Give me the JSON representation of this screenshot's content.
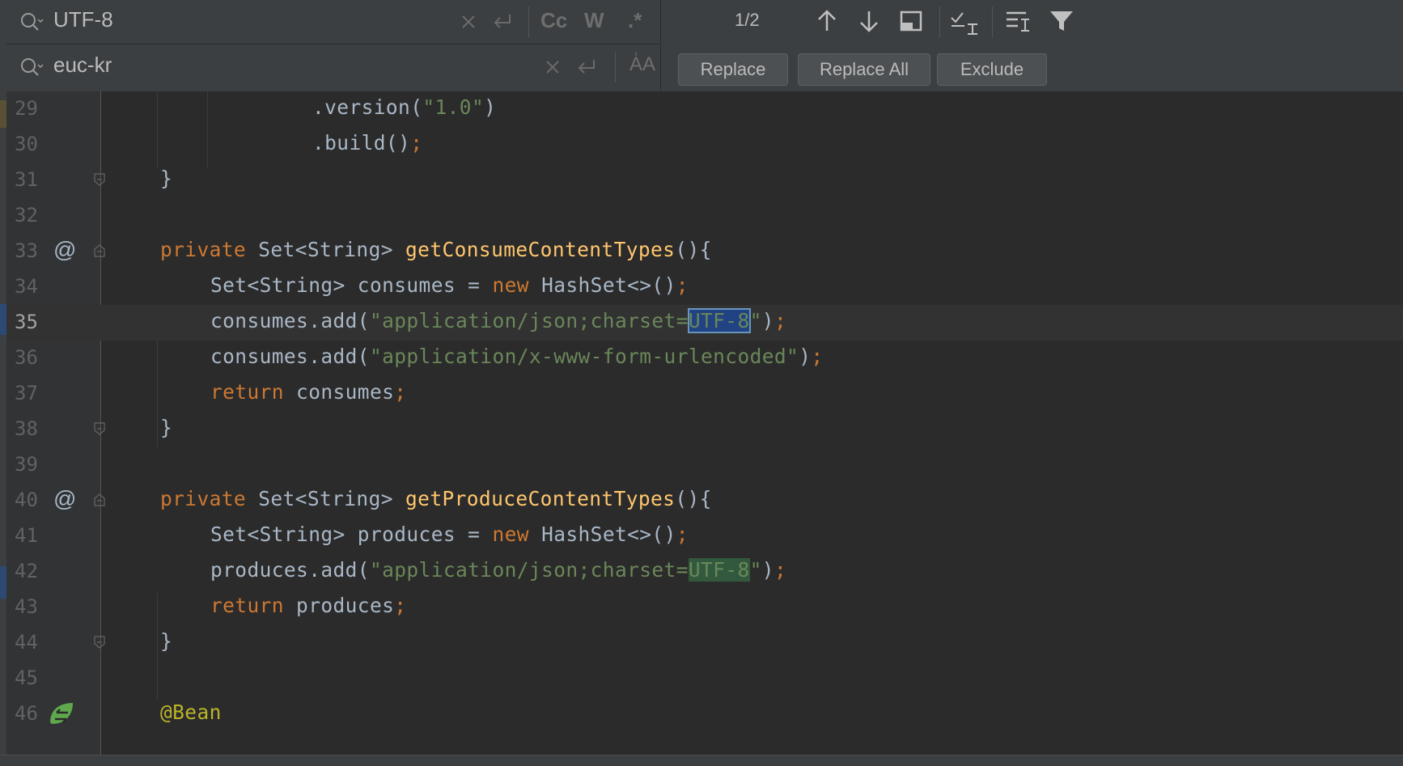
{
  "find": {
    "search_value": "UTF-8",
    "replace_value": "euc-kr",
    "match_count": "1/2",
    "options": {
      "match_case": "Cc",
      "words": "W",
      "regex": ".*"
    },
    "preserve_case": "A͑A"
  },
  "actions": {
    "replace": "Replace",
    "replace_all": "Replace All",
    "exclude": "Exclude"
  },
  "icons": {
    "search": "search-icon",
    "clear": "close-icon",
    "newline": "newline-icon",
    "prev": "arrow-up-icon",
    "next": "arrow-down-icon",
    "select_all": "select-all-occurrences-icon",
    "in_selection": "in-selection-icon",
    "multiline": "multiline-icon",
    "filter": "filter-icon"
  },
  "colors": {
    "keyword": "#cc7832",
    "string": "#6a8759",
    "function": "#ffc66d",
    "annotation": "#bbb529",
    "current_match": "#214283",
    "other_match": "#32593d"
  },
  "editor": {
    "lines": [
      {
        "num": "29"
      },
      {
        "num": "30"
      },
      {
        "num": "31"
      },
      {
        "num": "32"
      },
      {
        "num": "33"
      },
      {
        "num": "34"
      },
      {
        "num": "35"
      },
      {
        "num": "36"
      },
      {
        "num": "37"
      },
      {
        "num": "38"
      },
      {
        "num": "39"
      },
      {
        "num": "40"
      },
      {
        "num": "41"
      },
      {
        "num": "42"
      },
      {
        "num": "43"
      },
      {
        "num": "44"
      },
      {
        "num": "45"
      },
      {
        "num": "46"
      }
    ],
    "tokens": {
      "l29": ".version(",
      "l29s": "\"1.0\"",
      "l29e": ")",
      "l30": ".build()",
      "semi": ";",
      "brace_close": "}",
      "private": "private",
      "set_string": "Set<String>",
      "getConsume": "getConsumeContentTypes",
      "paren_brace": "(){",
      "l34_decl": "Set<String> consumes = ",
      "new": "new",
      "hashset": " HashSet<>()",
      "consumes_add": "consumes.add(",
      "str_json_prefix": "\"application/json;charset=",
      "utf8": "UTF-8",
      "quote": "\"",
      "close_paren": ")",
      "str_form": "\"application/x-www-form-urlencoded\"",
      "return": "return",
      "consumes_ret": " consumes",
      "getProduce": "getProduceContentTypes",
      "l41_decl": "Set<String> produces = ",
      "produces_add": "produces.add(",
      "produces_ret": " produces",
      "bean": "@Bean",
      "at": "@"
    }
  }
}
